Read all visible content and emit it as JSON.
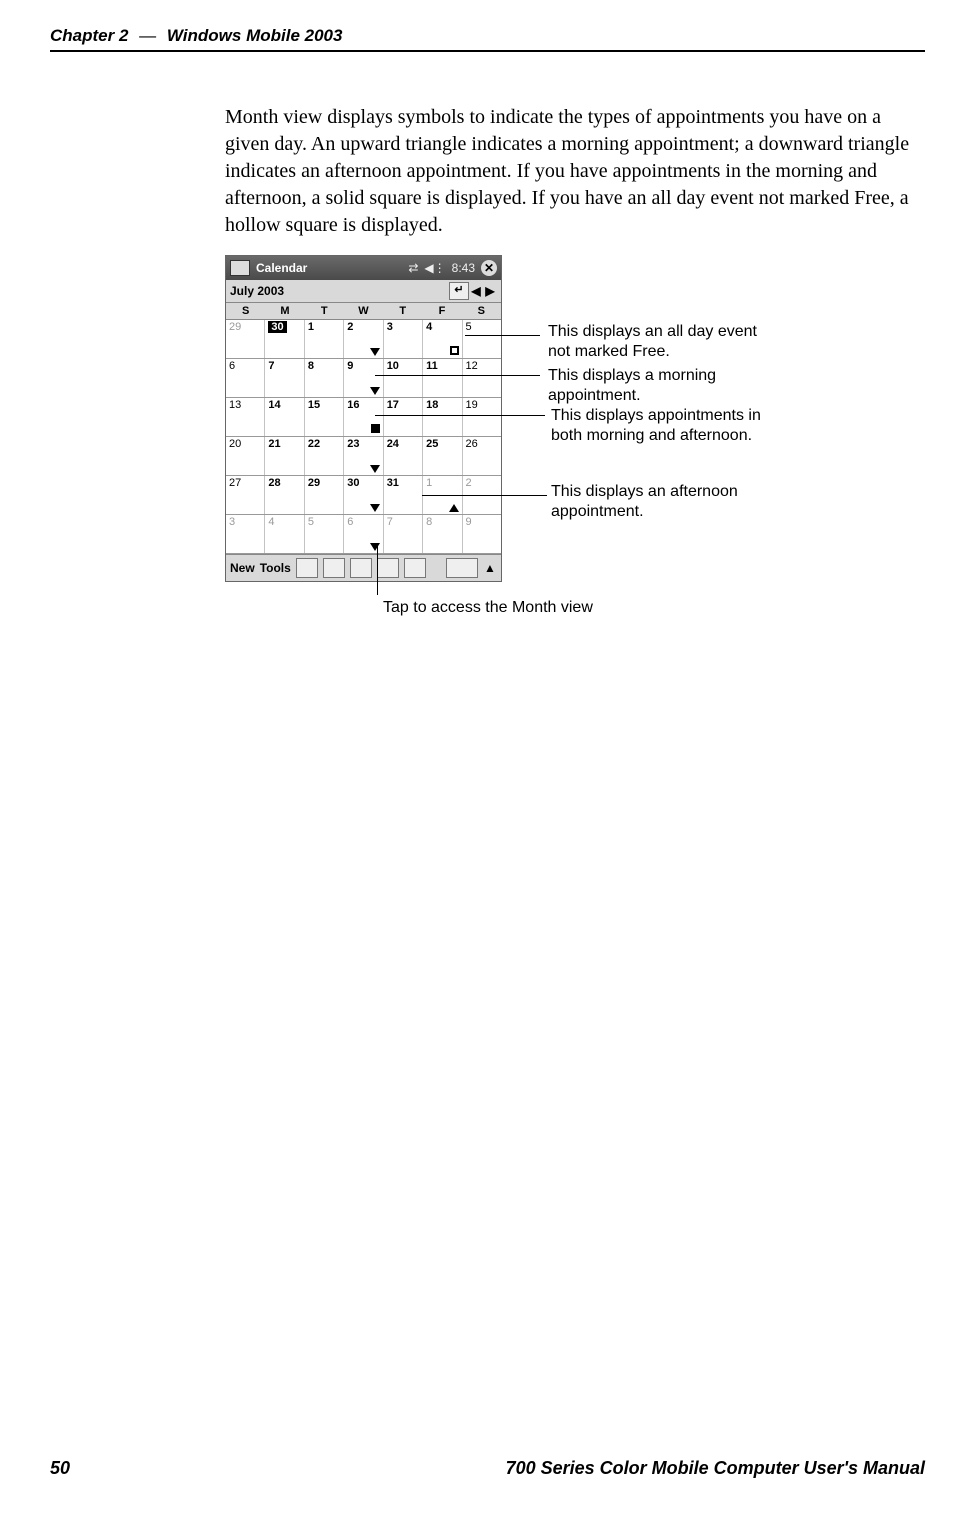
{
  "header": {
    "chapter": "Chapter 2",
    "dash": "—",
    "title": "Windows Mobile 2003"
  },
  "footer": {
    "page": "50",
    "book": "700 Series Color Mobile Computer User's Manual"
  },
  "paragraph": "Month view displays symbols to indicate the types of appointments you have on a given day. An upward triangle indicates a morning appointment; a downward triangle indicates an afternoon appointment. If you have appointments in the morning and afternoon, a solid square is displayed. If you have an all day event not marked Free, a hollow square is displayed.",
  "screenshot": {
    "app_title": "Calendar",
    "clock": "8:43",
    "month_label": "July 2003",
    "dow": [
      "S",
      "M",
      "T",
      "W",
      "T",
      "F",
      "S"
    ],
    "toolbar_new": "New",
    "toolbar_tools": "Tools",
    "weeks": [
      [
        {
          "n": "29",
          "cls": "dim"
        },
        {
          "n": "30",
          "cls": "today bold"
        },
        {
          "n": "1",
          "cls": "bold"
        },
        {
          "n": "2",
          "cls": "bold",
          "mark": "tri-dn"
        },
        {
          "n": "3",
          "cls": "bold"
        },
        {
          "n": "4",
          "cls": "bold",
          "mark": "sq-hollow"
        },
        {
          "n": "5",
          "cls": ""
        }
      ],
      [
        {
          "n": "6",
          "cls": ""
        },
        {
          "n": "7",
          "cls": "bold"
        },
        {
          "n": "8",
          "cls": "bold"
        },
        {
          "n": "9",
          "cls": "bold",
          "mark": "tri-dn"
        },
        {
          "n": "10",
          "cls": "bold"
        },
        {
          "n": "11",
          "cls": "bold"
        },
        {
          "n": "12",
          "cls": ""
        }
      ],
      [
        {
          "n": "13",
          "cls": ""
        },
        {
          "n": "14",
          "cls": "bold"
        },
        {
          "n": "15",
          "cls": "bold"
        },
        {
          "n": "16",
          "cls": "bold",
          "mark": "sq-solid"
        },
        {
          "n": "17",
          "cls": "bold"
        },
        {
          "n": "18",
          "cls": "bold"
        },
        {
          "n": "19",
          "cls": ""
        }
      ],
      [
        {
          "n": "20",
          "cls": ""
        },
        {
          "n": "21",
          "cls": "bold"
        },
        {
          "n": "22",
          "cls": "bold"
        },
        {
          "n": "23",
          "cls": "bold",
          "mark": "tri-dn"
        },
        {
          "n": "24",
          "cls": "bold"
        },
        {
          "n": "25",
          "cls": "bold"
        },
        {
          "n": "26",
          "cls": ""
        }
      ],
      [
        {
          "n": "27",
          "cls": ""
        },
        {
          "n": "28",
          "cls": "bold"
        },
        {
          "n": "29",
          "cls": "bold"
        },
        {
          "n": "30",
          "cls": "bold",
          "mark": "tri-dn"
        },
        {
          "n": "31",
          "cls": "bold"
        },
        {
          "n": "1",
          "cls": "dim",
          "mark": "tri-up"
        },
        {
          "n": "2",
          "cls": "dim"
        }
      ],
      [
        {
          "n": "3",
          "cls": "dim"
        },
        {
          "n": "4",
          "cls": "dim"
        },
        {
          "n": "5",
          "cls": "dim"
        },
        {
          "n": "6",
          "cls": "dim",
          "mark": "tri-dn"
        },
        {
          "n": "7",
          "cls": "dim"
        },
        {
          "n": "8",
          "cls": "dim"
        },
        {
          "n": "9",
          "cls": "dim"
        }
      ]
    ]
  },
  "callouts": {
    "allday": "This displays an all day event not marked Free.",
    "morning": "This displays a morning appointment.",
    "both": "This displays appointments in both morning and afternoon.",
    "afternoon": "This displays an afternoon appointment.",
    "monthview": "Tap to access the Month view"
  }
}
